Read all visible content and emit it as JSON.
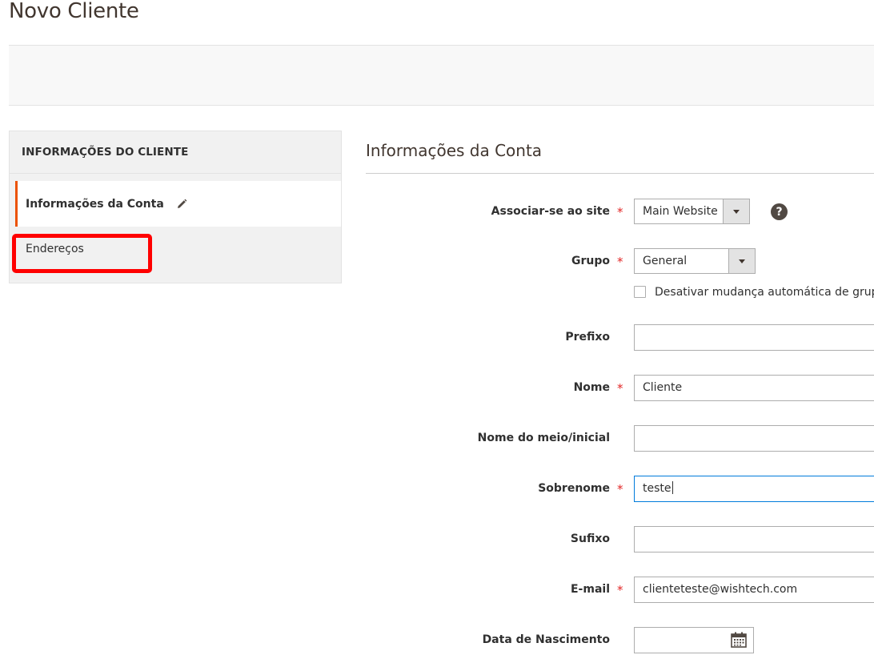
{
  "page": {
    "title": "Novo Cliente"
  },
  "sidebar": {
    "title": "INFORMAÇÕES DO CLIENTE",
    "items": [
      {
        "label": "Informações da Conta",
        "active": true
      },
      {
        "label": "Endereços",
        "active": false
      }
    ]
  },
  "form": {
    "section_title": "Informações da Conta",
    "website": {
      "label": "Associar-se ao site",
      "value": "Main Website",
      "required": true
    },
    "group": {
      "label": "Grupo",
      "value": "General",
      "required": true
    },
    "disable_auto_group": {
      "label": "Desativar mudança automática de grupo baseada no ID de IVA",
      "checked": false
    },
    "prefix": {
      "label": "Prefixo",
      "value": ""
    },
    "firstname": {
      "label": "Nome",
      "value": "Cliente",
      "required": true
    },
    "middlename": {
      "label": "Nome do meio/inicial",
      "value": ""
    },
    "lastname": {
      "label": "Sobrenome",
      "value": "teste",
      "required": true
    },
    "suffix": {
      "label": "Sufixo",
      "value": ""
    },
    "email": {
      "label": "E-mail",
      "value": "clienteteste@wishtech.com",
      "required": true
    },
    "dob": {
      "label": "Data de Nascimento",
      "value": ""
    },
    "required_mark": "*",
    "help_glyph": "?"
  },
  "colors": {
    "accent": "#eb5202",
    "required": "#e22626",
    "highlight": "#ff0000",
    "focus": "#007bdb"
  },
  "icons": {
    "edit": "pencil-icon",
    "help": "question-circle-icon",
    "calendar": "calendar-icon",
    "dropdown": "triangle-down-icon"
  }
}
